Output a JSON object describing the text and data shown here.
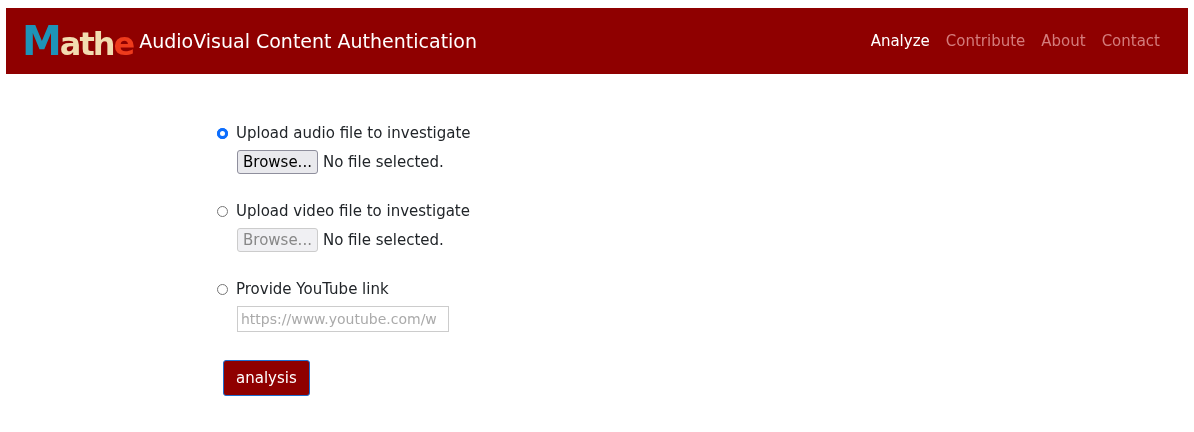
{
  "navbar": {
    "logo": "Mathe",
    "title": "AudioVisual Content Authentication",
    "links": [
      {
        "label": "Analyze",
        "selected": true
      },
      {
        "label": "Contribute",
        "selected": false
      },
      {
        "label": "About",
        "selected": false
      },
      {
        "label": "Contact",
        "selected": false
      }
    ]
  },
  "options": [
    {
      "kind": "file",
      "label": "Upload audio file to investigate",
      "selected": true,
      "button": "Browse...",
      "status": "No file selected.",
      "disabled": false
    },
    {
      "kind": "file",
      "label": "Upload video file to investigate",
      "selected": false,
      "button": "Browse...",
      "status": "No file selected.",
      "disabled": true
    },
    {
      "kind": "link",
      "label": "Provide YouTube link",
      "selected": false,
      "placeholder": "https://www.youtube.com/w",
      "disabled": true
    }
  ],
  "submit": "analysis"
}
